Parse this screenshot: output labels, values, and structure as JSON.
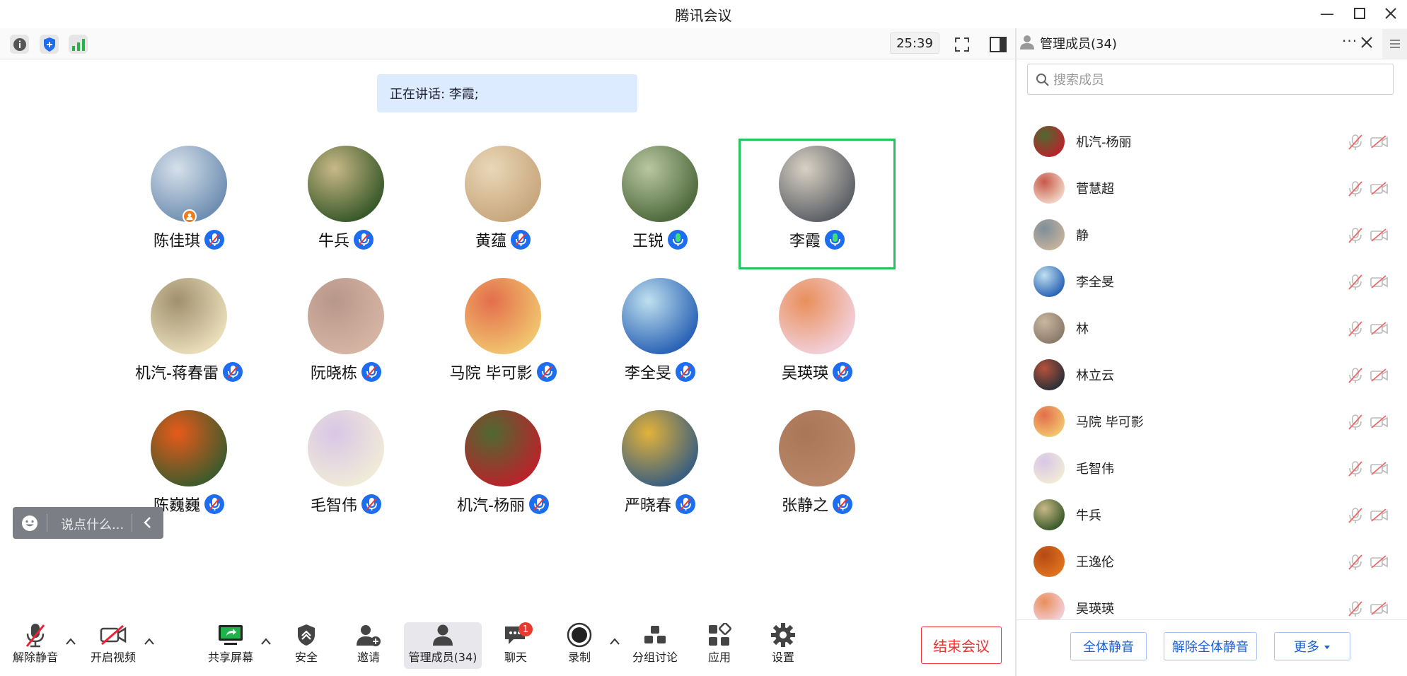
{
  "window": {
    "title": "腾讯会议"
  },
  "topbar": {
    "timer": "25:39"
  },
  "speaking": {
    "text": "正在讲话: 李霞;"
  },
  "grid": [
    {
      "name": "陈佳琪",
      "c1": "#6f8fb2",
      "c2": "#d6e0ea",
      "host": true
    },
    {
      "name": "牛兵",
      "c1": "#3a5a2a",
      "c2": "#c9b887"
    },
    {
      "name": "黄蕴",
      "c1": "#c8a77d",
      "c2": "#e9d7b8"
    },
    {
      "name": "王锐",
      "c1": "#4f6a3c",
      "c2": "#b9c7a2",
      "mic_live": true
    },
    {
      "name": "李霞",
      "c1": "#5d6066",
      "c2": "#d8d2c4",
      "mic_live": true,
      "active": true
    },
    {
      "name": "机汽-蒋春雷",
      "c1": "#e8dcb9",
      "c2": "#a0906e"
    },
    {
      "name": "阮晓栋",
      "c1": "#d6b4a4",
      "c2": "#b7978a"
    },
    {
      "name": "马院 毕可影",
      "c1": "#f1c46e",
      "c2": "#e36e4c"
    },
    {
      "name": "李全旻",
      "c1": "#2b63b6",
      "c2": "#bfe0ee"
    },
    {
      "name": "吴瑛瑛",
      "c1": "#f2cfd8",
      "c2": "#e98f5b"
    },
    {
      "name": "陈巍巍",
      "c1": "#3f5b2c",
      "c2": "#e85a1a"
    },
    {
      "name": "毛智伟",
      "c1": "#f0ead8",
      "c2": "#d9c6e6"
    },
    {
      "name": "机汽-杨丽",
      "c1": "#b8242a",
      "c2": "#4e6a33"
    },
    {
      "name": "严晓春",
      "c1": "#3b5f7f",
      "c2": "#e2b23a"
    },
    {
      "name": "张静之",
      "c1": "#b98768",
      "c2": "#a97657"
    }
  ],
  "chat": {
    "placeholder": "说点什么..."
  },
  "toolbar": {
    "unmute": "解除静音",
    "start_video": "开启视频",
    "share": "共享屏幕",
    "security": "安全",
    "invite": "邀请",
    "members": "管理成员(34)",
    "chat": "聊天",
    "chat_badge": "1",
    "record": "录制",
    "breakout": "分组讨论",
    "apps": "应用",
    "settings": "设置",
    "end": "结束会议"
  },
  "panel": {
    "title": "管理成员(34)",
    "search_placeholder": "搜索成员",
    "members": [
      {
        "name": "机汽-杨丽",
        "c1": "#b8242a",
        "c2": "#4e6a33"
      },
      {
        "name": "菅慧超",
        "c1": "#f1d2c2",
        "c2": "#c75a4a"
      },
      {
        "name": "静",
        "c1": "#c4b19c",
        "c2": "#7d8e9a"
      },
      {
        "name": "李全旻",
        "c1": "#2b63b6",
        "c2": "#bfe0ee"
      },
      {
        "name": "林",
        "c1": "#8a7a6a",
        "c2": "#c9b7a0"
      },
      {
        "name": "林立云",
        "c1": "#2c3038",
        "c2": "#b5523a"
      },
      {
        "name": "马院 毕可影",
        "c1": "#f1c46e",
        "c2": "#e36e4c"
      },
      {
        "name": "毛智伟",
        "c1": "#f0ead8",
        "c2": "#d9c6e6"
      },
      {
        "name": "牛兵",
        "c1": "#3a5a2a",
        "c2": "#c9b887"
      },
      {
        "name": "王逸伦",
        "c1": "#e0731f",
        "c2": "#b34a14"
      },
      {
        "name": "吴瑛瑛",
        "c1": "#f2cfd8",
        "c2": "#e98f5b"
      }
    ],
    "mute_all": "全体静音",
    "unmute_all": "解除全体静音",
    "more": "更多"
  }
}
